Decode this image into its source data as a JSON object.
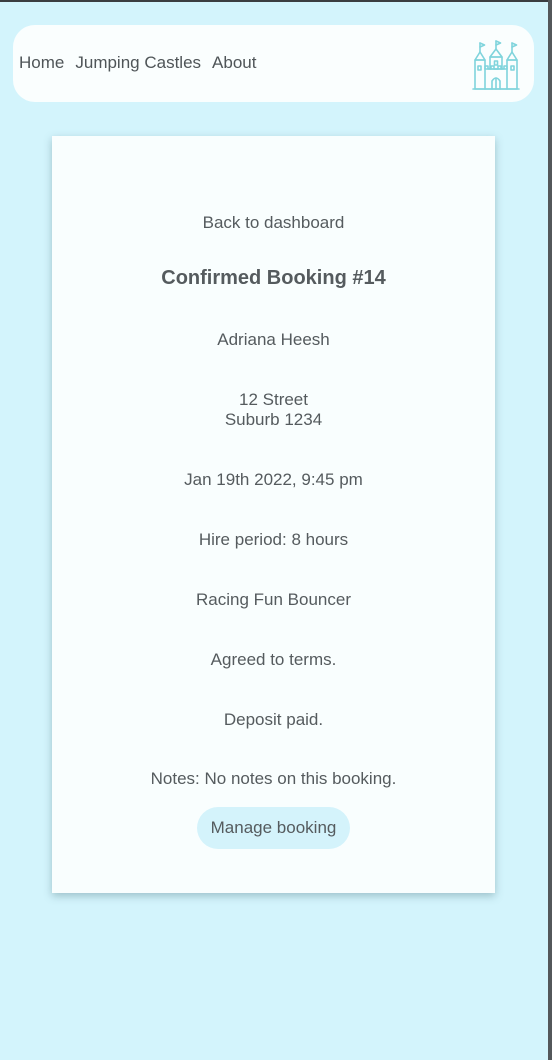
{
  "nav": {
    "links": [
      "Home",
      "Jumping Castles",
      "About"
    ],
    "logo_icon": "castle-icon",
    "accent_color": "#7fd4dc"
  },
  "booking": {
    "back_label": "Back to dashboard",
    "title": "Confirmed Booking #14",
    "customer_name": "Adriana Heesh",
    "address_line1": "12 Street",
    "address_line2": "Suburb 1234",
    "datetime": "Jan 19th 2022, 9:45 pm",
    "hire_period": "Hire period: 8 hours",
    "castle_name": "Racing Fun Bouncer",
    "terms_status": "Agreed to terms.",
    "deposit_status": "Deposit paid.",
    "notes": "Notes: No notes on this booking.",
    "manage_label": "Manage booking"
  },
  "colors": {
    "background": "#d3f4fc",
    "card": "#f9fefe",
    "button": "#d4f3fb",
    "text": "#555b5e"
  }
}
